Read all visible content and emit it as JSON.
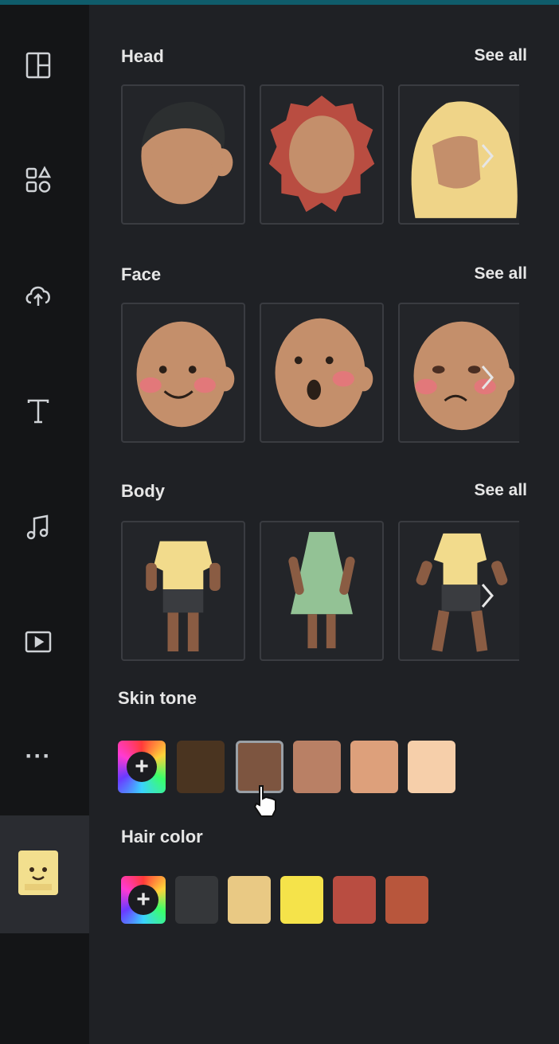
{
  "sections": {
    "head": {
      "title": "Head",
      "see_all": "See all"
    },
    "face": {
      "title": "Face",
      "see_all": "See all"
    },
    "body": {
      "title": "Body",
      "see_all": "See all"
    }
  },
  "skin_tone": {
    "label": "Skin tone",
    "add_label": "+",
    "colors": [
      "#4a3420",
      "#7d5540",
      "#b98065",
      "#dda07b",
      "#f6cfaa"
    ],
    "selected_index": 1
  },
  "hair_color": {
    "label": "Hair color",
    "add_label": "+",
    "colors": [
      "#35373a",
      "#e9c984",
      "#f5e34a",
      "#b94d41",
      "#b8563c"
    ]
  },
  "rail": {
    "icons": [
      "layout-icon",
      "elements-icon",
      "upload-icon",
      "text-icon",
      "music-icon",
      "video-icon",
      "more-icon",
      "character-icon"
    ],
    "more_label": "···"
  },
  "colors": {
    "panel_bg": "#1f2125",
    "rail_bg": "#141517",
    "accent_top": "#0f5c6b",
    "skin_default": "#c48f6b"
  }
}
